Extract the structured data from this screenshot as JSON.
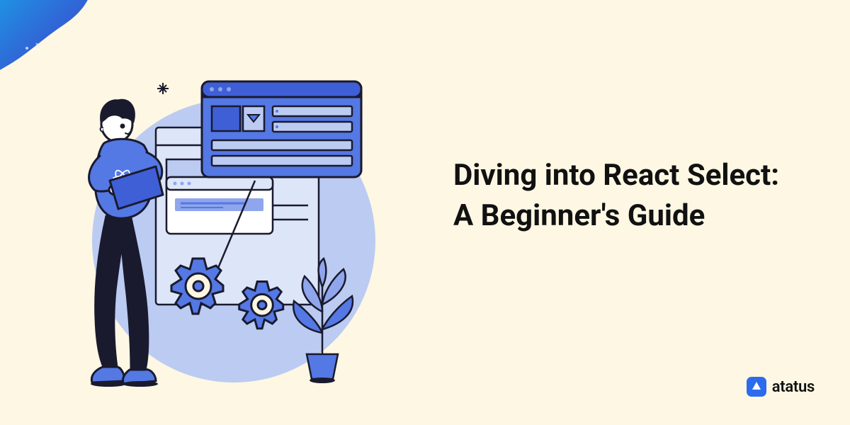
{
  "title": "Diving into React Select: A Beginner's Guide",
  "brand": {
    "name": "atatus"
  },
  "colors": {
    "background": "#FDF7E3",
    "primary": "#5478E4",
    "primaryDark": "#3F5FD6",
    "accent": "#2C6BED",
    "text": "#111111",
    "illustrationLight": "#BCCBF2",
    "illustrationMid": "#8FA5EC"
  }
}
